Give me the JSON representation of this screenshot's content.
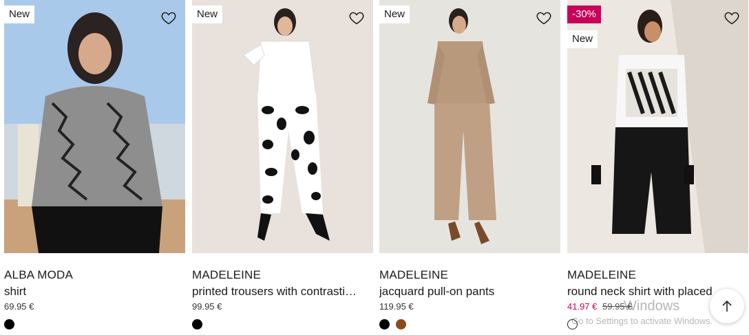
{
  "products": [
    {
      "badges": [
        "New"
      ],
      "brand": "ALBA MODA",
      "name": "shirt",
      "price": "69.95 €",
      "sale_price": "",
      "old_price": "",
      "swatches": [
        "#000000"
      ]
    },
    {
      "badges": [
        "New"
      ],
      "brand": "MADELEINE",
      "name": "printed trousers with contrasti…",
      "price": "99.95 €",
      "sale_price": "",
      "old_price": "",
      "swatches": [
        "#000000"
      ]
    },
    {
      "badges": [
        "New"
      ],
      "brand": "MADELEINE",
      "name": "jacquard pull-on pants",
      "price": "119.95 €",
      "sale_price": "",
      "old_price": "",
      "swatches": [
        "#000000",
        "#8b4a1c"
      ]
    },
    {
      "badges": [
        "-30%",
        "New"
      ],
      "brand": "MADELEINE",
      "name": "round neck shirt with placed …",
      "price": "",
      "sale_price": "41.97 €",
      "old_price": "59.95 €",
      "swatches": [
        "#ffffff"
      ]
    }
  ],
  "icons": {
    "wishlist": "heart-outline",
    "scroll_top": "arrow-up"
  },
  "colors": {
    "sale_badge": "#c8005a",
    "sale_price": "#c8005a"
  },
  "overlay": {
    "watermark_title": "Windows",
    "watermark_sub": "Go to Settings to activate Windows."
  }
}
